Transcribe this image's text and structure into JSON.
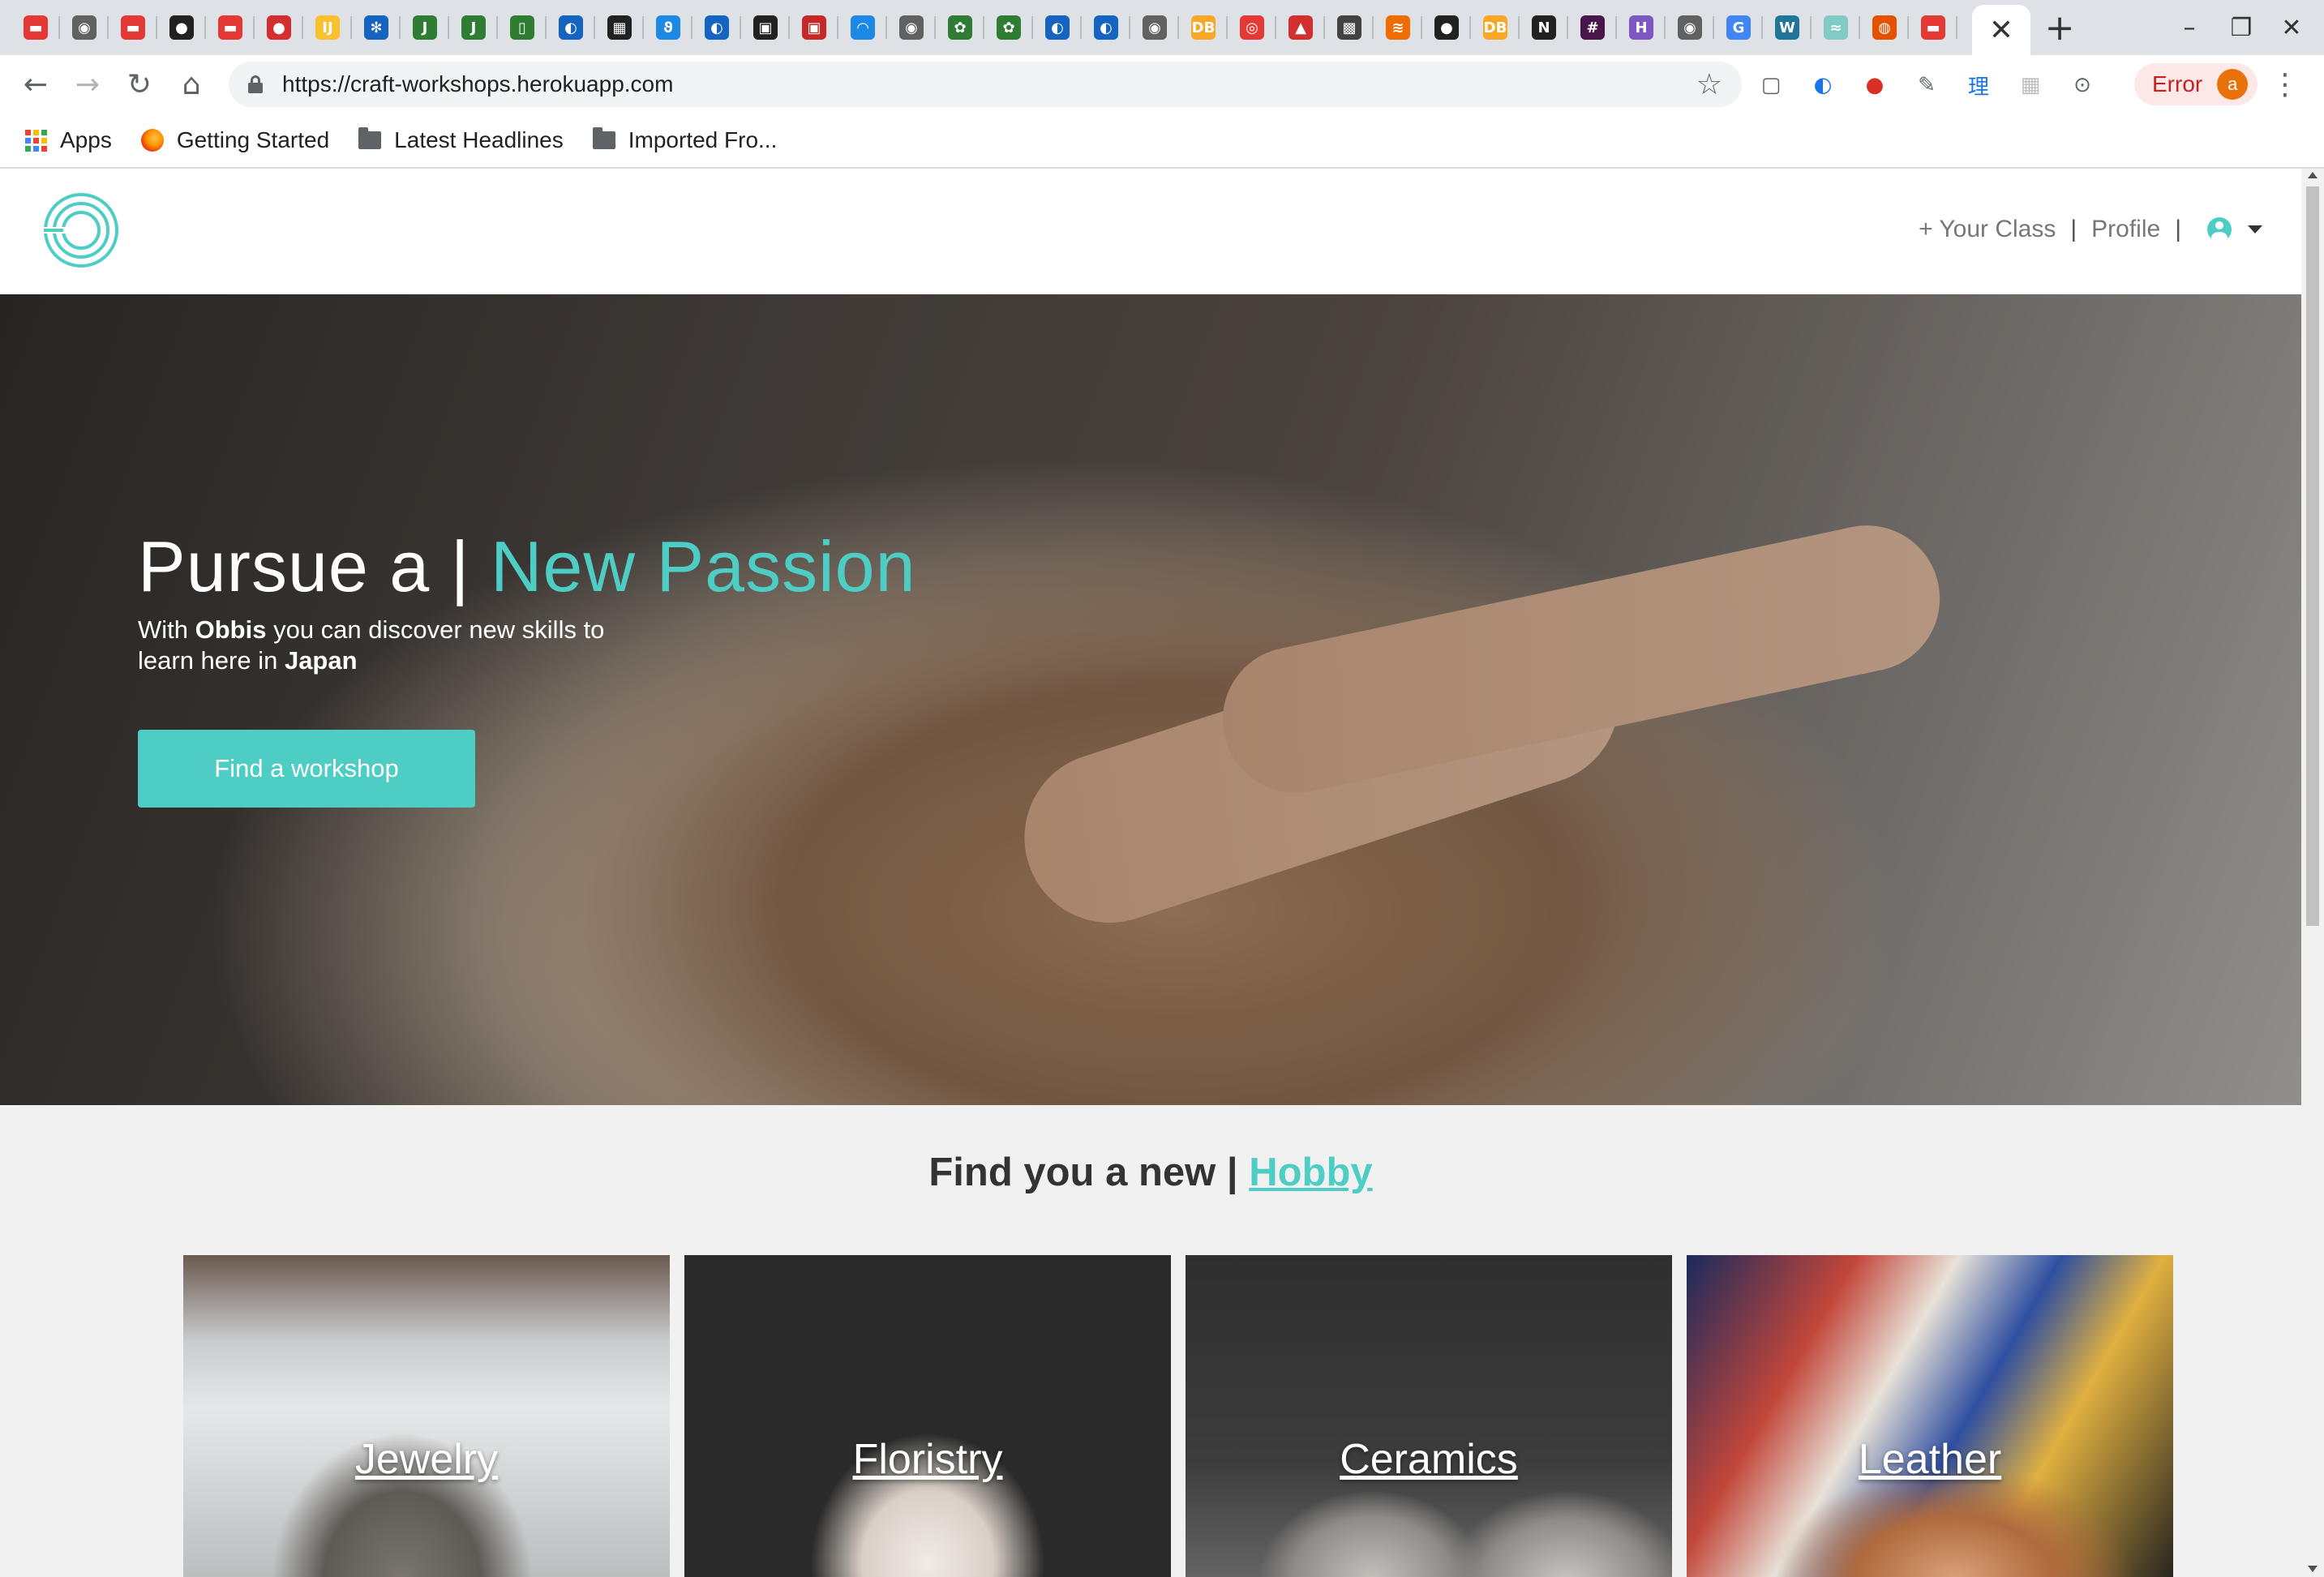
{
  "browser": {
    "tab_close_glyph": "✕",
    "new_tab_glyph": "+",
    "window": {
      "minimize": "–",
      "restore": "❐",
      "close": "✕"
    },
    "favicons": [
      {
        "g": "▬",
        "c": "#e53935"
      },
      {
        "g": "◉",
        "c": "#616161"
      },
      {
        "g": "▬",
        "c": "#e53935"
      },
      {
        "g": "●",
        "c": "#212121"
      },
      {
        "g": "▬",
        "c": "#e53935"
      },
      {
        "g": "●",
        "c": "#d32f2f"
      },
      {
        "g": "IJ",
        "c": "#fbc02d"
      },
      {
        "g": "✻",
        "c": "#1565c0"
      },
      {
        "g": "J",
        "c": "#2e7d32"
      },
      {
        "g": "J",
        "c": "#2e7d32"
      },
      {
        "g": "▯",
        "c": "#2e7d32"
      },
      {
        "g": "◐",
        "c": "#1565c0"
      },
      {
        "g": "▦",
        "c": "#212121"
      },
      {
        "g": "ϑ",
        "c": "#1e88e5"
      },
      {
        "g": "◐",
        "c": "#1565c0"
      },
      {
        "g": "▣",
        "c": "#212121"
      },
      {
        "g": "▣",
        "c": "#c62828"
      },
      {
        "g": "◠",
        "c": "#1e88e5"
      },
      {
        "g": "◉",
        "c": "#616161"
      },
      {
        "g": "✿",
        "c": "#2e7d32"
      },
      {
        "g": "✿",
        "c": "#2e7d32"
      },
      {
        "g": "◐",
        "c": "#1565c0"
      },
      {
        "g": "◐",
        "c": "#1565c0"
      },
      {
        "g": "◉",
        "c": "#616161"
      },
      {
        "g": "DB",
        "c": "#f9a825"
      },
      {
        "g": "◎",
        "c": "#e53935"
      },
      {
        "g": "▲",
        "c": "#d32f2f"
      },
      {
        "g": "▩",
        "c": "#424242"
      },
      {
        "g": "≋",
        "c": "#ef6c00"
      },
      {
        "g": "●",
        "c": "#212121"
      },
      {
        "g": "DB",
        "c": "#f9a825"
      },
      {
        "g": "N",
        "c": "#212121"
      },
      {
        "g": "#",
        "c": "#4a154b"
      },
      {
        "g": "H",
        "c": "#7e57c2"
      },
      {
        "g": "◉",
        "c": "#616161"
      },
      {
        "g": "G",
        "c": "#4285f4"
      },
      {
        "g": "W",
        "c": "#21759b"
      },
      {
        "g": "≈",
        "c": "#80cbc4"
      },
      {
        "g": "◍",
        "c": "#e65100"
      },
      {
        "g": "▬",
        "c": "#e53935"
      }
    ],
    "nav": {
      "back": "←",
      "forward": "→",
      "reload": "↻",
      "home": "⌂"
    },
    "url": "https://craft-workshops.herokuapp.com",
    "bookmark_star": "☆",
    "extensions": [
      {
        "g": "▢",
        "c": "#5f6368"
      },
      {
        "g": "◐",
        "c": "#1a73e8"
      },
      {
        "g": "●",
        "c": "#d93025"
      },
      {
        "g": "✎",
        "c": "#5f6368"
      },
      {
        "g": "理",
        "c": "#1a73e8"
      },
      {
        "g": "▦",
        "c": "#bdbdbd"
      },
      {
        "g": "⊙",
        "c": "#5f6368"
      }
    ],
    "error_label": "Error",
    "profile_initial": "a",
    "menu_glyph": "⋮",
    "bookmarks": [
      {
        "label": "Apps",
        "icon": "apps-icon"
      },
      {
        "label": "Getting Started",
        "icon": "firefox-icon"
      },
      {
        "label": "Latest Headlines",
        "icon": "folder-icon"
      },
      {
        "label": "Imported Fro...",
        "icon": "folder-icon"
      }
    ]
  },
  "site": {
    "nav": {
      "add_class": "+ Your Class",
      "separator": "|",
      "profile": "Profile"
    },
    "hero": {
      "title_prefix": "Pursue a | ",
      "title_accent": "New Passion",
      "sub_1": "With ",
      "sub_brand": "Obbis",
      "sub_2": " you can discover new skills to learn here in ",
      "sub_country": "Japan",
      "cta": "Find a workshop"
    },
    "hobby": {
      "title_prefix": "Find you a new | ",
      "title_link": "Hobby",
      "categories": [
        "Jewelry",
        "Floristry",
        "Ceramics",
        "Leather"
      ]
    },
    "colors": {
      "accent": "#4ecdc4"
    }
  }
}
